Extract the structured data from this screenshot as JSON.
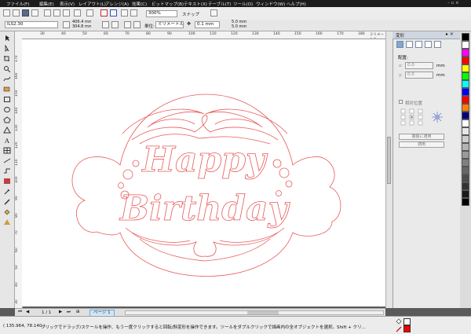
{
  "menu": [
    "ファイル(F)",
    "編集(E)",
    "表示(V)",
    "レイアウト(L)",
    "アレンジ(A)",
    "効果(C)",
    "ビットマップ(B)",
    "テキスト(X)",
    "テーブル(T)",
    "ツール(O)",
    "ウィンドウ(W)",
    "ヘルプ(H)"
  ],
  "toolbar": {
    "zoom": "300%",
    "snap_label": "スナップ"
  },
  "propbar": {
    "paper_size": "ILS2.30",
    "width": "406.4 mm",
    "height": "304.8 mm",
    "unit_label": "単位:",
    "unit": "ミリメートル",
    "nudge": "0.1 mm",
    "dup_x": "5.0 mm",
    "dup_y": "5.0 mm"
  },
  "ruler": {
    "h_ticks": [
      "30",
      "40",
      "50",
      "60",
      "70",
      "80",
      "90",
      "100",
      "110",
      "120",
      "130",
      "140",
      "150",
      "160",
      "170",
      "180",
      "190"
    ],
    "h_unit": "ミリメートル",
    "v_ticks": [
      "170",
      "160",
      "150",
      "140",
      "130",
      "120",
      "110",
      "100",
      "90",
      "80",
      "70",
      "60",
      "50",
      "40",
      "30"
    ]
  },
  "docker": {
    "header": "変形",
    "section": "配置:",
    "x_value": "0.0",
    "y_value": "0.0",
    "x_unit": "mm",
    "y_unit": "mm",
    "relative_label": "相対位置",
    "apply_copy": "複製に適用",
    "apply": "適用"
  },
  "palette": [
    "#000000",
    "#ffffff",
    "#ff00ff",
    "#ff0000",
    "#ffff00",
    "#00ff00",
    "#00ffff",
    "#0000ff",
    "#ff0000",
    "#ff8000",
    "#000080",
    "#ffffff",
    "#e6e6e6",
    "#cccccc",
    "#b3b3b3",
    "#999999",
    "#808080",
    "#666666",
    "#4d4d4d",
    "#333333",
    "#1a1a1a",
    "#000000"
  ],
  "pages": {
    "counter": "1 / 1",
    "tab": "ページ 1"
  },
  "status": {
    "coords": "( 135.964, 78.140 )",
    "message": "クリックでドラッグ/スケールを操作、もう一度クリックすると回転/斜変形を操作できます。ツールをダブルクリックで描画内の全オブジェクトを選択。Shift + クリ..."
  },
  "design": {
    "line1": "Happy",
    "line2": "Birthday",
    "stroke_color": "#e85a5a"
  }
}
